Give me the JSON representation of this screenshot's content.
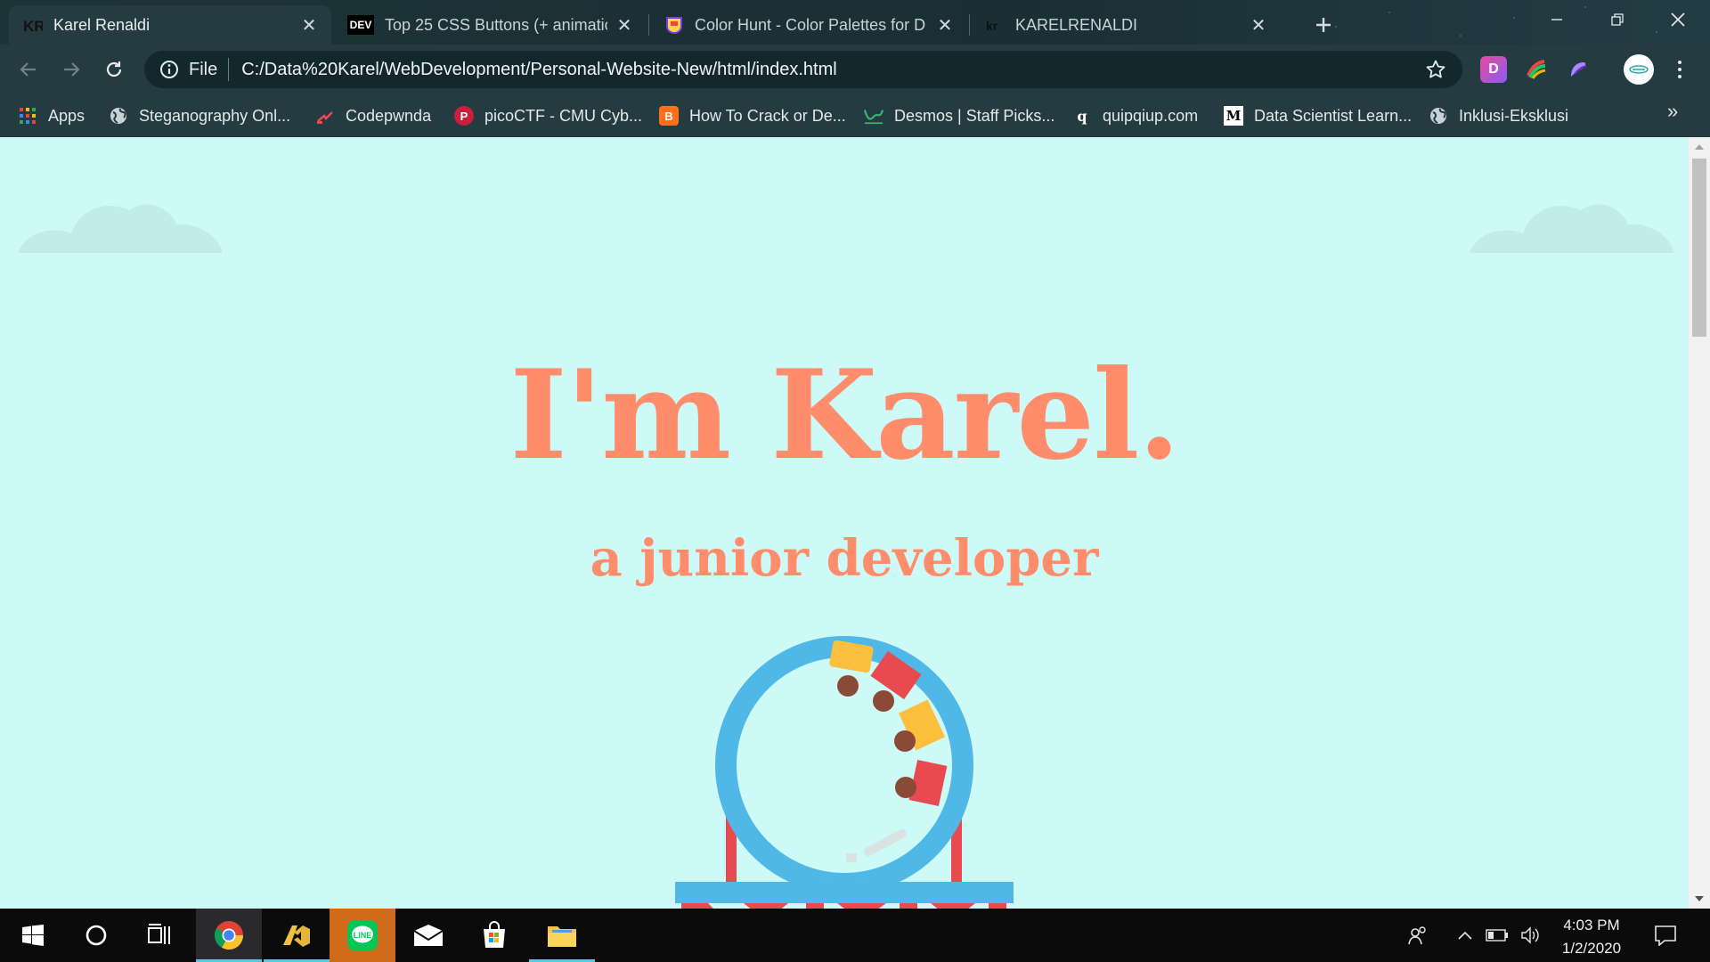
{
  "browser": {
    "tabs": [
      {
        "title": "Karel Renaldi",
        "favicon": "KR",
        "active": true
      },
      {
        "title": "Top 25 CSS Buttons (+ animation",
        "favicon": "DEV",
        "active": false
      },
      {
        "title": "Color Hunt - Color Palettes for D",
        "favicon": "color-hunt-icon",
        "active": false
      },
      {
        "title": "KARELRENALDI",
        "favicon": "kr",
        "active": false
      }
    ],
    "address": {
      "scheme_label": "File",
      "url": "C:/Data%20Karel/WebDevelopment/Personal-Website-New/html/index.html"
    },
    "extensions": [
      {
        "name": "dashlane-extension",
        "label": "D"
      },
      {
        "name": "colorful-extension",
        "label": ""
      },
      {
        "name": "purple-extension",
        "label": ""
      }
    ],
    "bookmarks": [
      {
        "label": "Apps",
        "icon": "apps-grid-icon"
      },
      {
        "label": "Steganography Onl...",
        "icon": "globe-icon"
      },
      {
        "label": "Codepwnda",
        "icon": "codepwnda-icon"
      },
      {
        "label": "picoCTF - CMU Cyb...",
        "icon": "picoctf-icon",
        "glyph": "P"
      },
      {
        "label": "How To Crack or De...",
        "icon": "blogger-icon",
        "glyph": "B"
      },
      {
        "label": "Desmos | Staff Picks...",
        "icon": "desmos-icon"
      },
      {
        "label": "quipqiup.com",
        "icon": "quipqiup-icon",
        "glyph": "q"
      },
      {
        "label": "Data Scientist Learn...",
        "icon": "medium-icon",
        "glyph": "M"
      },
      {
        "label": "Inklusi-Eksklusi",
        "icon": "globe-icon"
      }
    ],
    "bookmarks_overflow": "»"
  },
  "page": {
    "title": "I'm Karel.",
    "subtitle": "a junior developer",
    "colors": {
      "background": "#cdf9f7",
      "accent": "#ff8c6b",
      "ring": "#4fb8e6",
      "coaster_red": "#e84a4f",
      "coaster_yellow": "#fcbf3d",
      "seat": "#8a4a35"
    }
  },
  "taskbar": {
    "apps": [
      {
        "name": "start-button",
        "icon": "windows-icon"
      },
      {
        "name": "search-button",
        "icon": "cortana-icon"
      },
      {
        "name": "task-view-button",
        "icon": "task-view-icon"
      },
      {
        "name": "chrome-app",
        "icon": "chrome-icon",
        "active": true
      },
      {
        "name": "vscode-app",
        "icon": "visual-studio-icon",
        "active": true
      },
      {
        "name": "line-app",
        "icon": "line-icon",
        "label": "LINE"
      },
      {
        "name": "mail-app",
        "icon": "mail-icon"
      },
      {
        "name": "store-app",
        "icon": "store-icon"
      },
      {
        "name": "explorer-app",
        "icon": "folder-icon",
        "active": true
      }
    ],
    "clock": {
      "time": "4:03 PM",
      "date": "1/2/2020"
    }
  }
}
